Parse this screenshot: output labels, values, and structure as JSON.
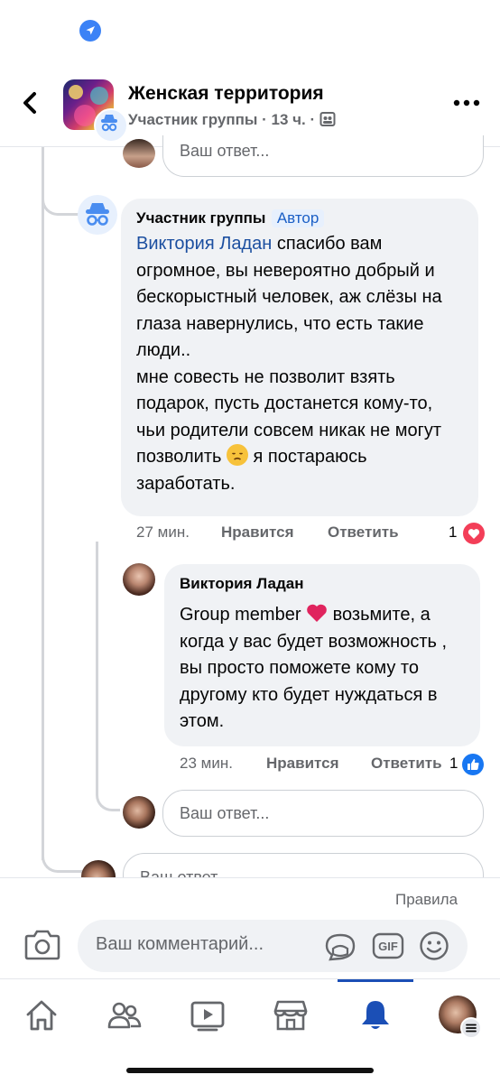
{
  "header": {
    "title": "Женская территория",
    "subtitle_role": "Участник группы",
    "subtitle_time": "13 ч."
  },
  "thread": {
    "reply_placeholder": "Ваш ответ...",
    "reply_placeholder_cut": "Ваш ответ..."
  },
  "comment1": {
    "author": "Участник группы",
    "badge": "Автор",
    "mention": "Виктория Ладан",
    "text_part1": " спасибо вам огромное, вы невероятно добрый и бескорыстный человек, аж слёзы на глаза навернулись, что есть такие люди..",
    "text_part2": "мне совесть не позволит взять подарок, пусть достанется кому-то, чьи родители совсем никак не могут позволить",
    "text_part3": " я постараюсь заработать.",
    "time": "27 мин.",
    "like_label": "Нравится",
    "reply_label": "Ответить",
    "reaction_count": "1",
    "reaction": "heart"
  },
  "comment2": {
    "author": "Виктория Ладан",
    "text_part1": "Group member ",
    "text_part2": " возьмите, а когда у вас будет возможность , вы просто поможете кому то другому кто будет нуждаться в этом.",
    "time": "23 мин.",
    "like_label": "Нравится",
    "reply_label": "Ответить",
    "reaction_count": "1",
    "reaction": "like"
  },
  "composer": {
    "rules_label": "Правила",
    "placeholder": "Ваш комментарий..."
  },
  "tabs": [
    "home",
    "groups",
    "watch",
    "marketplace",
    "notifications",
    "menu"
  ],
  "colors": {
    "accent": "#1b4fb6",
    "mention": "#1c4fa0",
    "badge_bg": "#e7f0fd",
    "bubble_bg": "#f0f2f5",
    "heart": "#e0245e",
    "like": "#1877f2"
  }
}
